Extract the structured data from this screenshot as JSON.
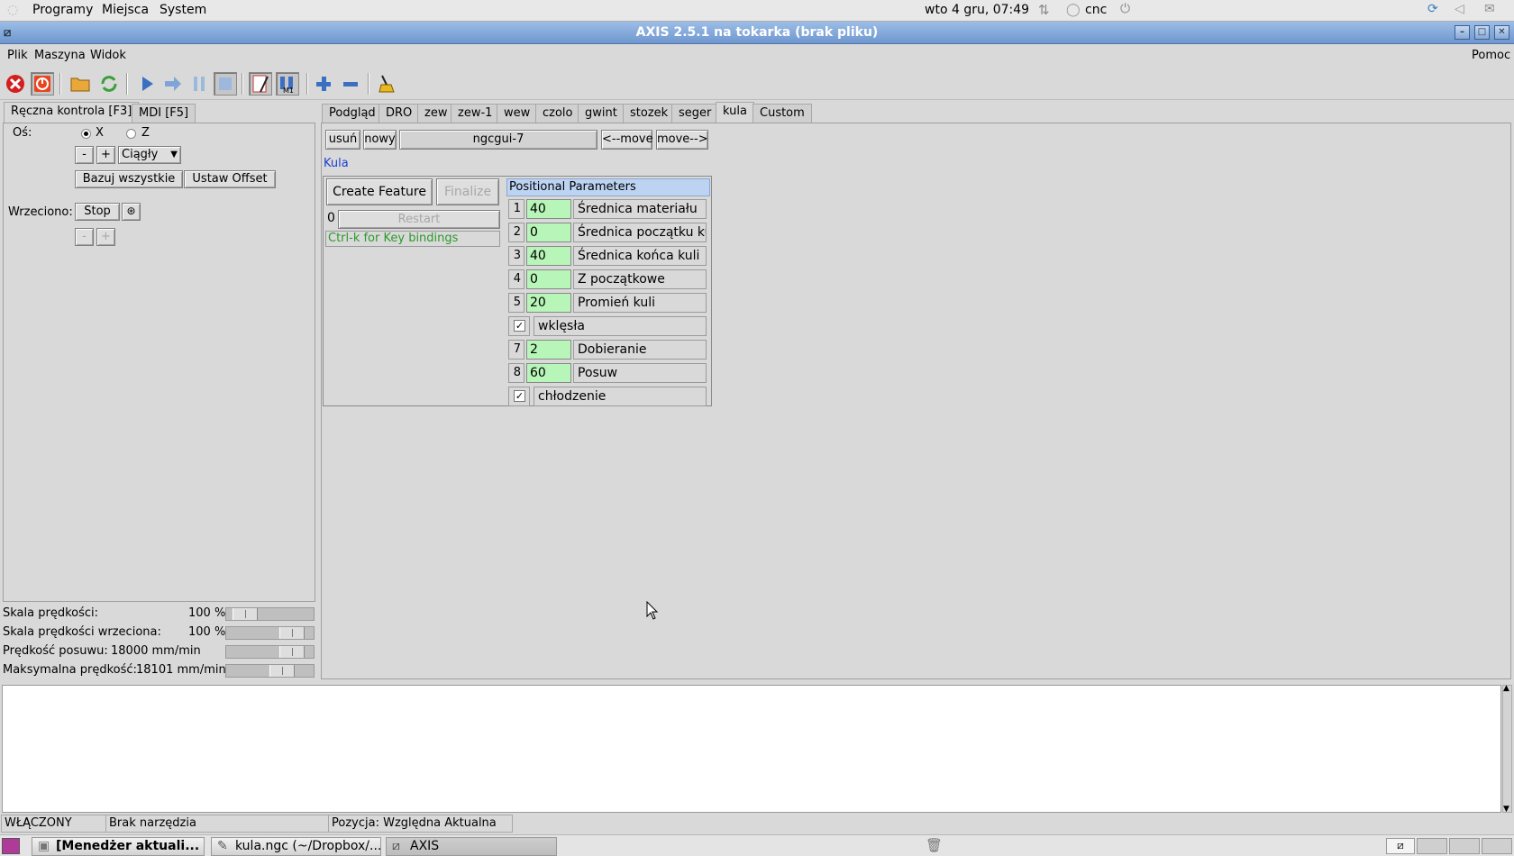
{
  "top_panel": {
    "menus": [
      "Programy",
      "Miejsca",
      "System"
    ],
    "clock": "wto  4 gru, 07:49",
    "user": "cnc"
  },
  "window": {
    "title": "AXIS 2.5.1 na tokarka (brak pliku)",
    "menu": [
      "Plik",
      "Maszyna",
      "Widok"
    ],
    "help": "Pomoc"
  },
  "left_tabs": [
    "Ręczna kontrola [F3]",
    "MDI [F5]"
  ],
  "manual": {
    "axis_label": "Oś:",
    "axis_x": "X",
    "axis_z": "Z",
    "minus": "-",
    "plus": "+",
    "jog_mode": "Ciągły",
    "home_all": "Bazuj wszystkie",
    "set_offset": "Ustaw Offset",
    "spindle_label": "Wrzeciono:",
    "spindle_stop": "Stop"
  },
  "sliders": [
    {
      "label": "Skala prędkości:",
      "value": "100 %",
      "fraction": 0.1
    },
    {
      "label": "Skala prędkości wrzeciona:",
      "value": "100 %",
      "fraction": 0.85
    },
    {
      "label": "Prędkość posuwu:",
      "value": "18000 mm/min",
      "fraction": 0.85
    },
    {
      "label": "Maksymalna prędkość:",
      "value": "18101 mm/min",
      "fraction": 0.7
    }
  ],
  "right_tabs": [
    "Podgląd",
    "DRO",
    "zew",
    "zew-1",
    "wew",
    "czolo",
    "gwint",
    "stozek",
    "seger",
    "kula",
    "Custom"
  ],
  "ngcgui": {
    "remove": "usuń",
    "new": "nowy",
    "page_name": "ngcgui-7",
    "move_left": "<--move",
    "move_right": "move-->",
    "feature_name": "Kula",
    "create_feature": "Create Feature",
    "finalize": "Finalize",
    "counter": "0",
    "restart": "Restart",
    "hint": "Ctrl-k for Key bindings",
    "params_title": "Positional Parameters",
    "params": [
      {
        "num": "1",
        "value": "40",
        "name": "Średnica materiału"
      },
      {
        "num": "2",
        "value": "0",
        "name": "Średnica początku kuli"
      },
      {
        "num": "3",
        "value": "40",
        "name": "Średnica końca kuli"
      },
      {
        "num": "4",
        "value": "0",
        "name": "Z początkowe"
      },
      {
        "num": "5",
        "value": "20",
        "name": "Promień kuli"
      },
      {
        "check": "✓",
        "name": "wklęsła"
      },
      {
        "num": "7",
        "value": "2",
        "name": "Dobieranie"
      },
      {
        "num": "8",
        "value": "60",
        "name": "Posuw"
      },
      {
        "check": "✓",
        "name": "chłodzenie"
      }
    ]
  },
  "status": {
    "state": "WŁĄCZONY",
    "tool": "Brak narzędzia",
    "position": "Pozycja: Względna Aktualna"
  },
  "taskbar": [
    "[Menedżer aktuali...",
    "kula.ngc (~/Dropbox/...",
    "AXIS"
  ],
  "colors": {
    "param_value_bg": "#b8f5b8",
    "title_bar": "#7aa0d4",
    "hint_text": "#2a9a2a",
    "feature_label": "#1a3fd0"
  }
}
